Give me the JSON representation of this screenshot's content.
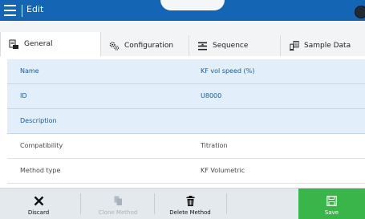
{
  "header": {
    "title": "Edit"
  },
  "tabs": [
    {
      "label": "General",
      "icon": "general-icon",
      "active": true
    },
    {
      "label": "Configuration",
      "icon": "configuration-icon",
      "active": false
    },
    {
      "label": "Sequence",
      "icon": "sequence-icon",
      "active": false
    },
    {
      "label": "Sample Data",
      "icon": "sample-data-icon",
      "active": false
    }
  ],
  "rows": [
    {
      "label": "Name",
      "value": "KF vol speed (%)"
    },
    {
      "label": "ID",
      "value": "U8000"
    },
    {
      "label": "Description",
      "value": ""
    },
    {
      "label": "Compatibility",
      "value": "Titration"
    },
    {
      "label": "Method type",
      "value": "KF Volumetric"
    }
  ],
  "toolbar": {
    "discard": "Discard",
    "clone": "Clone Method",
    "delete": "Delete Method",
    "save": "Save"
  },
  "colors": {
    "header": "#1565b5",
    "highlight_row": "#e2eef9",
    "save": "#3ab54a"
  }
}
